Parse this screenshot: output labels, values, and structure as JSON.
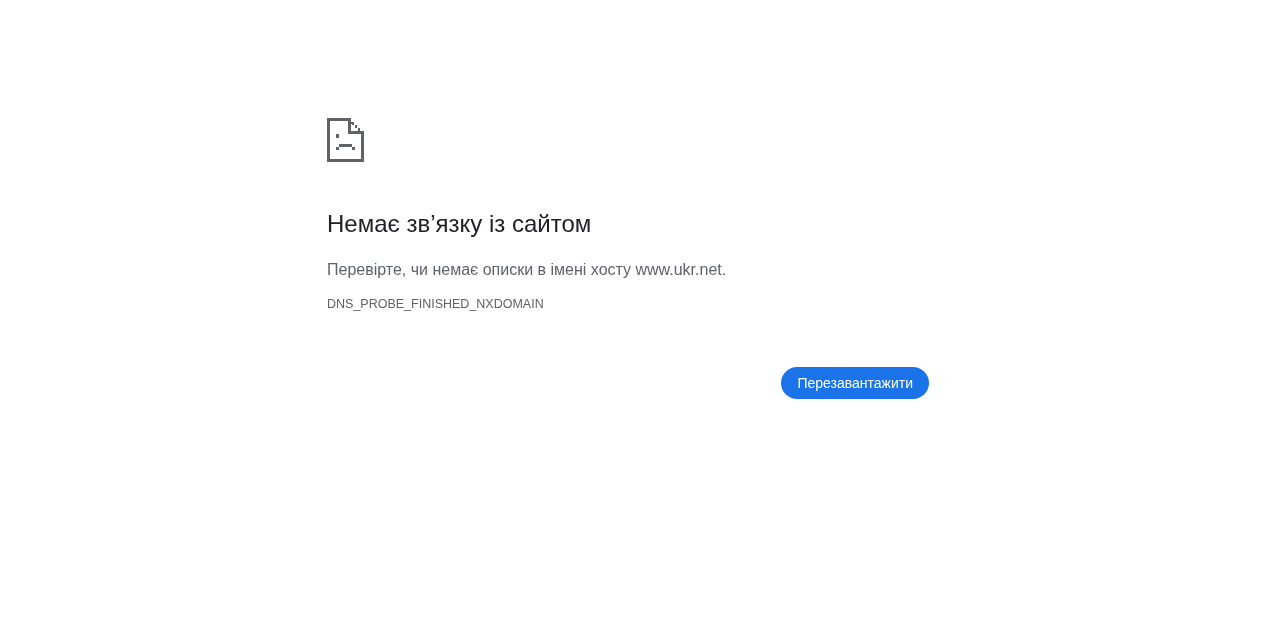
{
  "heading": "Немає зв’язку із сайтом",
  "message": "Перевірте, чи немає описки в імені хосту www.ukr.net.",
  "error_code": "DNS_PROBE_FINISHED_NXDOMAIN",
  "buttons": [
    "Перезавантажити"
  ]
}
